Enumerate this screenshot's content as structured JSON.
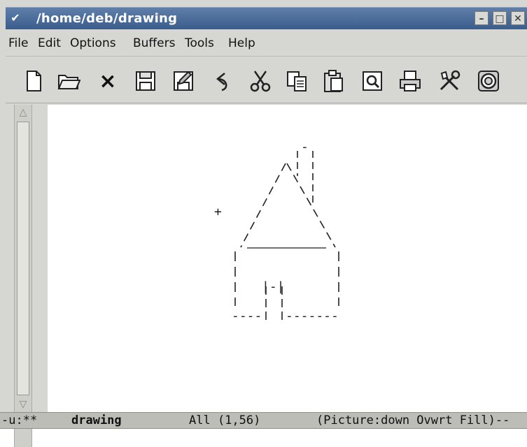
{
  "window": {
    "title": "/home/deb/drawing",
    "menu_glyph": "✔",
    "minimize_glyph": "–",
    "maximize_glyph": "□",
    "close_glyph": "✕"
  },
  "menubar": {
    "items": [
      "File",
      "Edit",
      "Options",
      "Buffers",
      "Tools",
      "Help"
    ]
  },
  "toolbar": {
    "buttons": [
      {
        "icon": "new-file-icon"
      },
      {
        "icon": "open-folder-icon"
      },
      {
        "icon": "close-x-icon",
        "glyph": "×"
      },
      {
        "icon": "save-icon"
      },
      {
        "icon": "save-as-icon"
      },
      {
        "icon": "undo-icon"
      },
      {
        "icon": "cut-scissors-icon"
      },
      {
        "icon": "copy-icon"
      },
      {
        "icon": "paste-icon"
      },
      {
        "icon": "search-icon"
      },
      {
        "icon": "print-icon"
      },
      {
        "icon": "preferences-tools-icon"
      },
      {
        "icon": "help-lifebuoy-icon"
      }
    ]
  },
  "scrollbar": {
    "up_glyph": "△",
    "down_glyph": "▽"
  },
  "drawing": {
    "cursor": "+",
    "chimney_top": "-",
    "door_top": "|-|",
    "ground_left": "----",
    "ground_right": "-------"
  },
  "modeline": {
    "status": "-u:**",
    "buffer_name": "drawing",
    "position": "All (1,56)",
    "modes": "(Picture:down Ovwrt Fill)--"
  },
  "minibuffer": {
    "text": ""
  }
}
